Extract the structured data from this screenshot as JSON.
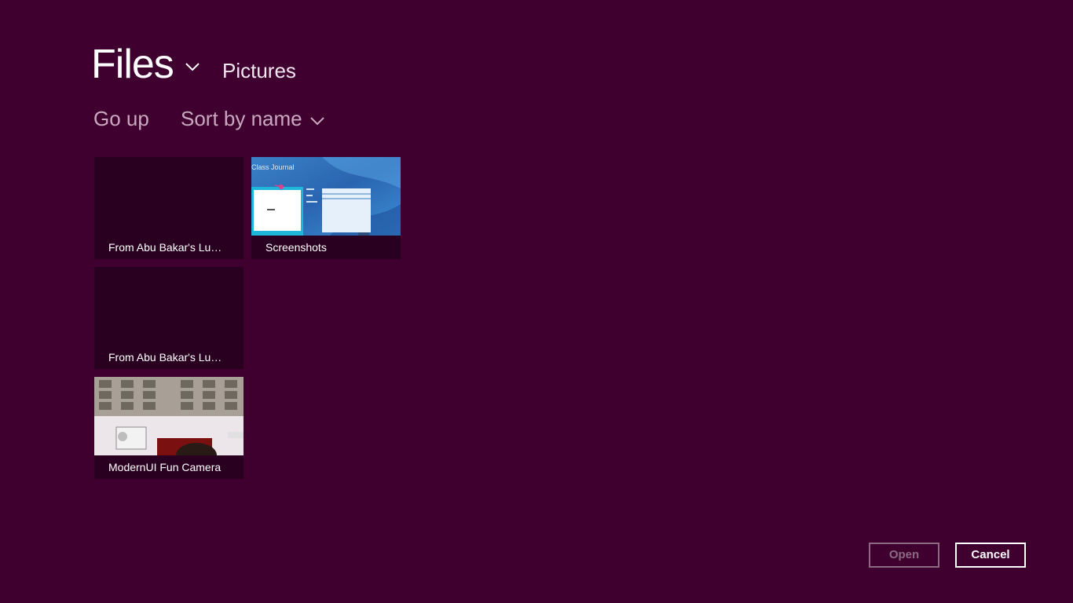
{
  "header": {
    "app_title": "Files",
    "location": "Pictures"
  },
  "toolbar": {
    "go_up": "Go up",
    "sort": "Sort by name"
  },
  "items": [
    {
      "label": "From Abu Bakar's Lu…"
    },
    {
      "label": "Screenshots",
      "thumbnail_text": "Class Journal"
    },
    {
      "label": "From Abu Bakar's Lu…"
    },
    {
      "label": "ModernUI Fun Camera"
    }
  ],
  "footer": {
    "open_label": "Open",
    "cancel_label": "Cancel"
  },
  "colors": {
    "background": "#3f0030",
    "tile_background": "#2a0020",
    "muted_text": "#c9a8c0",
    "disabled_button": "#8a6b82"
  }
}
